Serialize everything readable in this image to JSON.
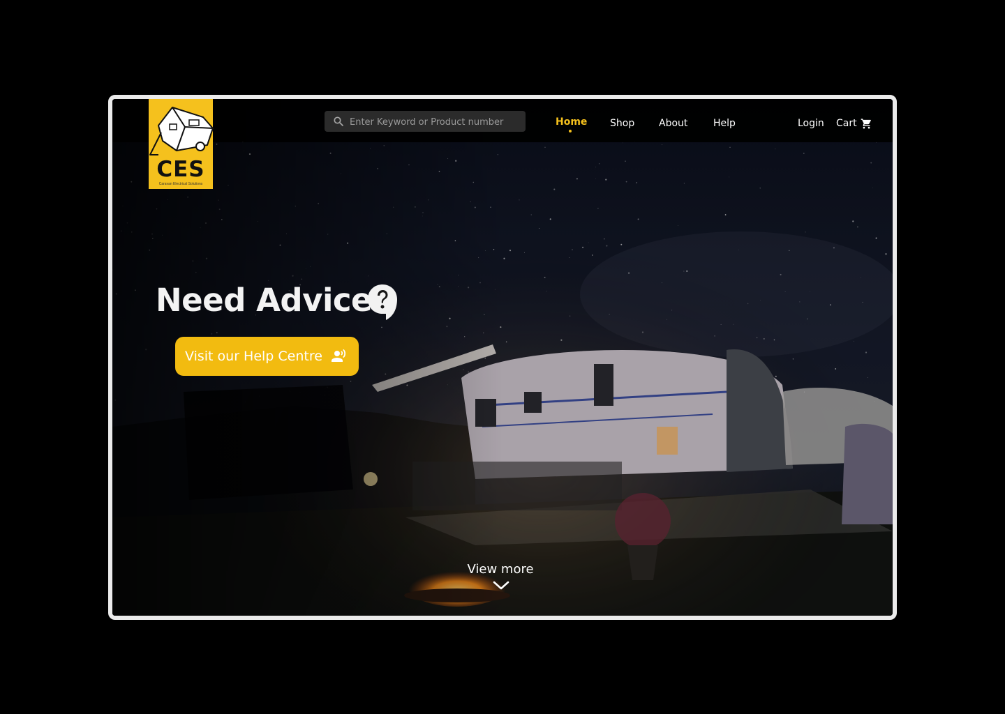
{
  "brand": {
    "logo_text": "CES",
    "logo_subtitle": "Caravan Electrical Solutions",
    "accent_color": "#f5c11d"
  },
  "search": {
    "placeholder": "Enter Keyword or Product number",
    "icon": "search-icon"
  },
  "nav": {
    "items": [
      {
        "label": "Home",
        "active": true
      },
      {
        "label": "Shop",
        "active": false
      },
      {
        "label": "About",
        "active": false
      },
      {
        "label": "Help",
        "active": false
      }
    ],
    "login": "Login",
    "cart": "Cart",
    "cart_icon": "cart-icon"
  },
  "hero": {
    "title": "Need Advice",
    "title_icon": "question-bubble-icon",
    "button_label": "Visit our Help Centre",
    "button_icon": "speaking-person-icon",
    "view_more": "View more",
    "view_more_icon": "chevron-down-icon"
  }
}
